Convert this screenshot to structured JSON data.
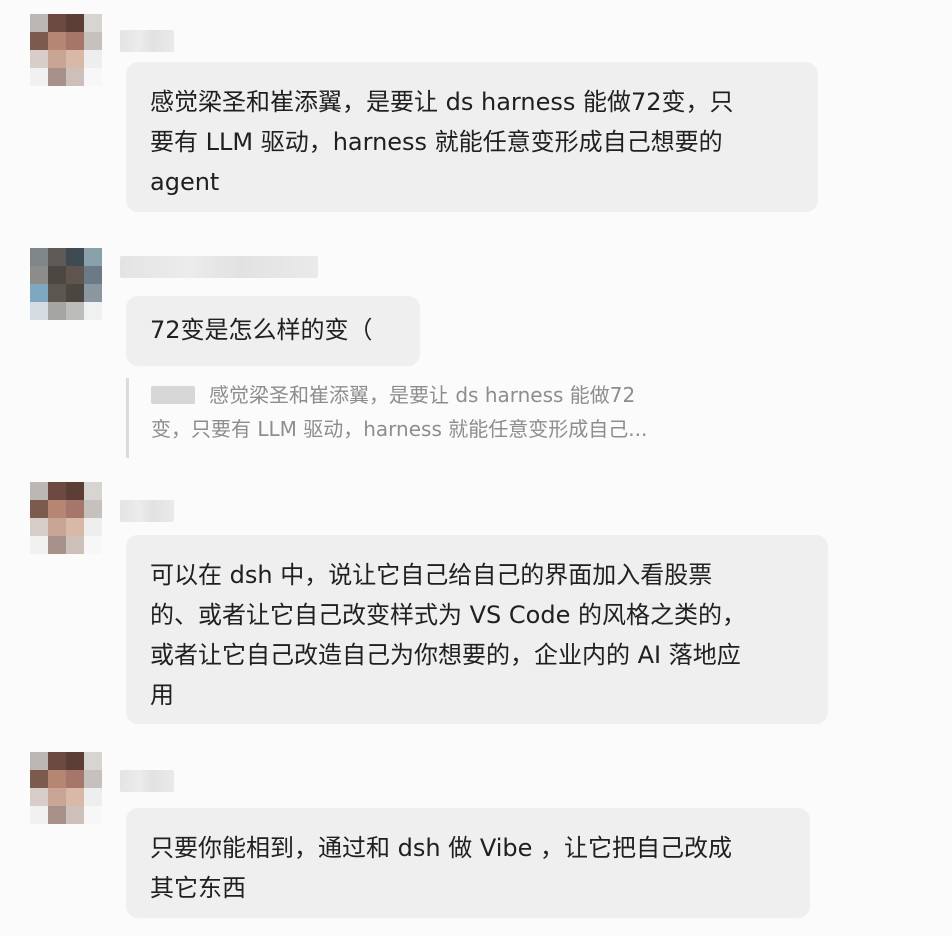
{
  "messages": [
    {
      "lines": [
        "感觉梁圣和崔添翼，是要让 ds harness 能做72变，只",
        "要有 LLM 驱动，harness 就能任意变形成自己想要的",
        "agent"
      ]
    },
    {
      "lines": [
        "72变是怎么样的变（"
      ],
      "quote": {
        "lines": [
          "感觉梁圣和崔添翼，是要让 ds harness 能做72",
          "变，只要有 LLM 驱动，harness 就能任意变形成自己..."
        ]
      }
    },
    {
      "lines": [
        "可以在 dsh 中，说让它自己给自己的界面加入看股票",
        "的、或者让它自己改变样式为 VS Code 的风格之类的，",
        "或者让它自己改造自己为你想要的，企业内的 AI 落地应",
        "用"
      ]
    },
    {
      "lines": [
        "只要你能相到，通过和 dsh 做 Vibe ，让它把自己改成",
        "其它东西"
      ]
    }
  ]
}
